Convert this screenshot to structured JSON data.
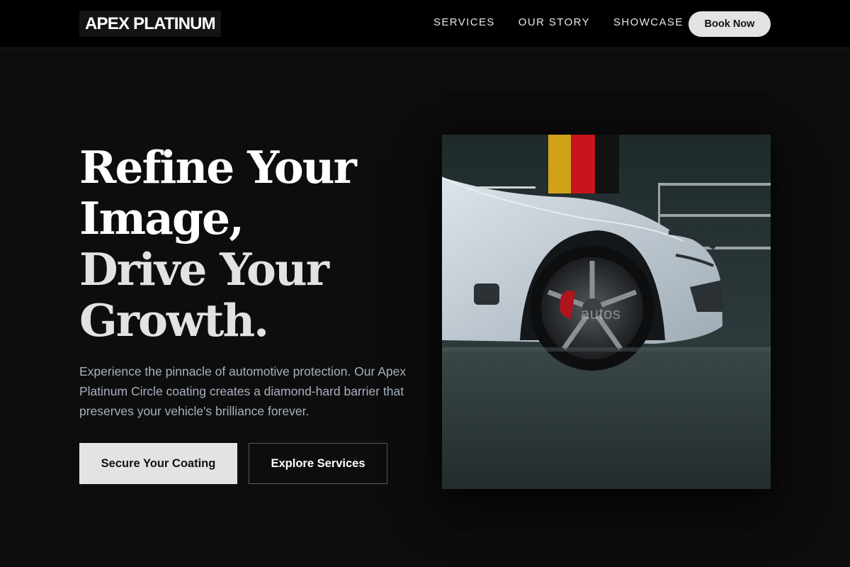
{
  "brand": {
    "name": "APEX PLATINUM"
  },
  "nav": {
    "links": [
      {
        "label": "SERVICES"
      },
      {
        "label": "OUR STORY"
      },
      {
        "label": "SHOWCASE"
      }
    ],
    "cta_label": "Book Now"
  },
  "hero": {
    "headline_line1": "Refine Your",
    "headline_line2": "Image,",
    "headline_line3": "Drive Your",
    "headline_line4": "Growth.",
    "description": "Experience the pinnacle of automotive protection. Our Apex Platinum Circle coating creates a diamond-hard barrier that preserves your vehicle's brilliance forever.",
    "primary_button": "Secure Your Coating",
    "secondary_button": "Explore Services",
    "image_watermark": "autos"
  },
  "colors": {
    "background": "#0d0d0d",
    "navbar": "#000000",
    "button_light": "#e3e3e3",
    "body_text": "#a7b1c0"
  }
}
